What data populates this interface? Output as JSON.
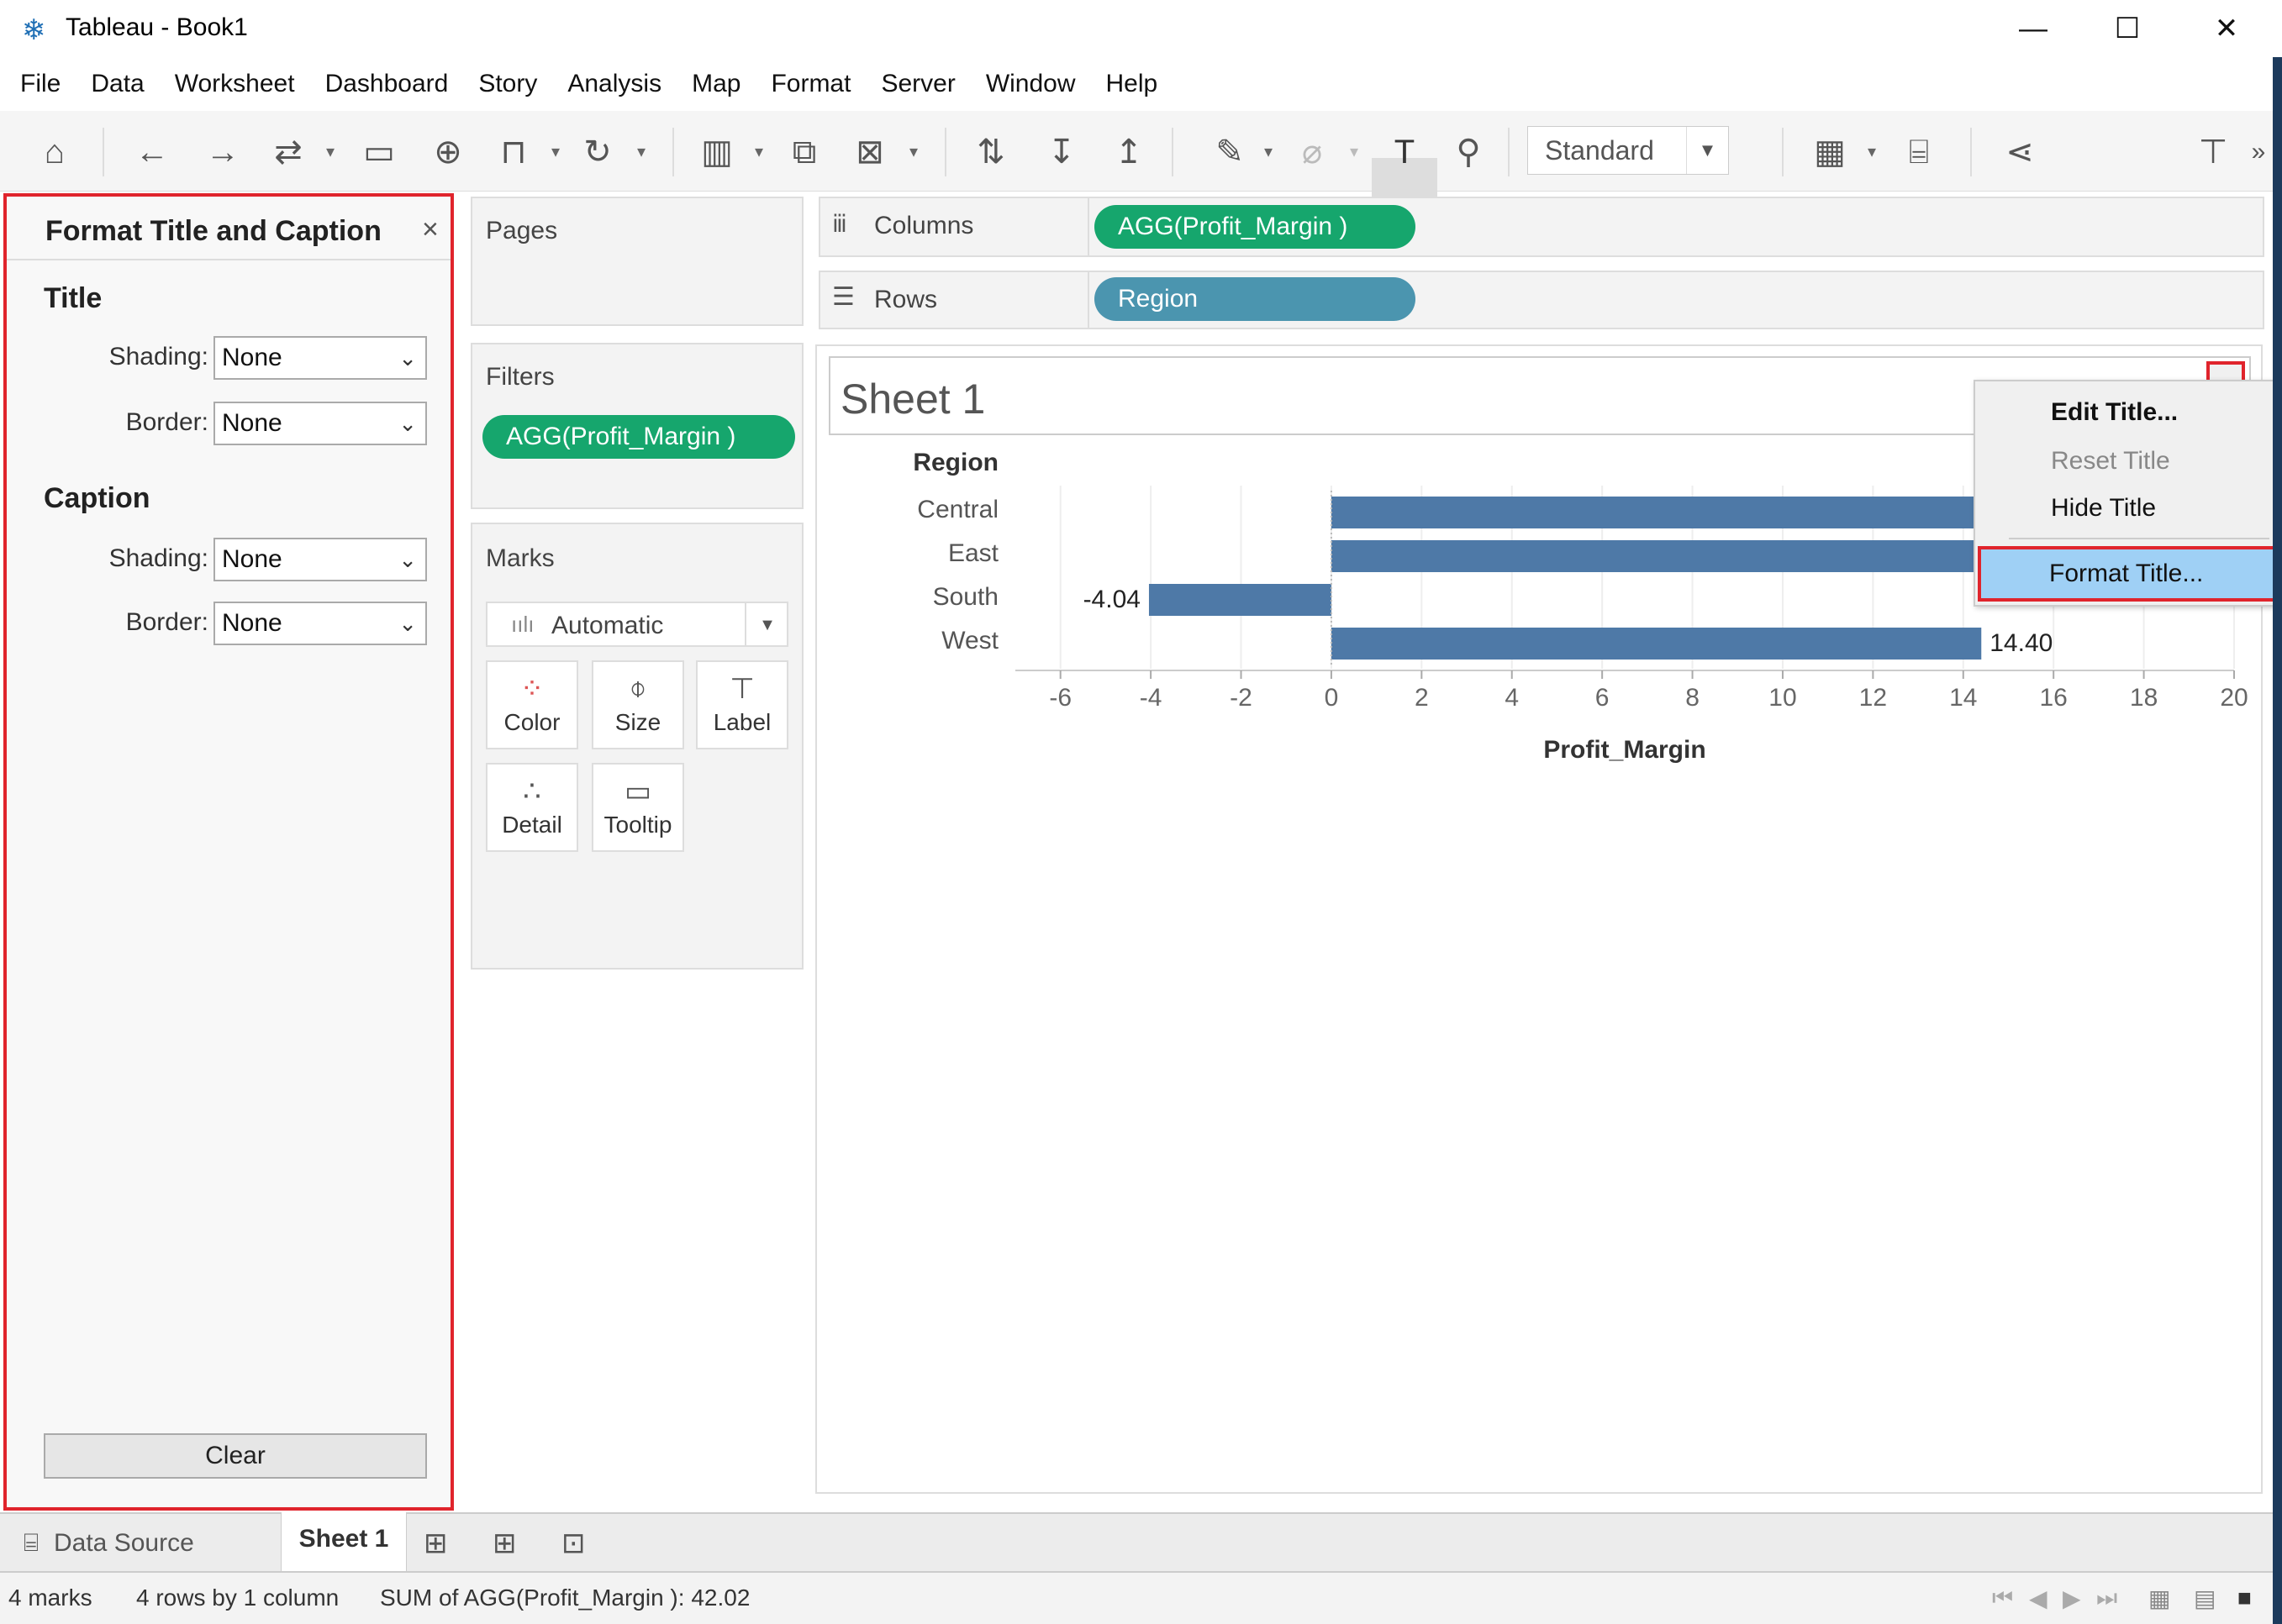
{
  "window": {
    "title": "Tableau - Book1",
    "minimize": "—",
    "maximize": "☐",
    "close": "✕"
  },
  "menu": [
    "File",
    "Data",
    "Worksheet",
    "Dashboard",
    "Story",
    "Analysis",
    "Map",
    "Format",
    "Server",
    "Window",
    "Help"
  ],
  "toolbar": {
    "fit_value": "Standard"
  },
  "format_panel": {
    "header": "Format Title and Caption",
    "close": "×",
    "title_section": "Title",
    "caption_section": "Caption",
    "shading_label": "Shading:",
    "border_label": "Border:",
    "title_shading": "None",
    "title_border": "None",
    "caption_shading": "None",
    "caption_border": "None",
    "clear_label": "Clear"
  },
  "cards": {
    "pages": "Pages",
    "filters": "Filters",
    "filter_pill": "AGG(Profit_Margin )",
    "marks": "Marks",
    "mark_type": "Automatic",
    "mark_buttons": [
      "Color",
      "Size",
      "Label",
      "Detail",
      "Tooltip"
    ]
  },
  "shelves": {
    "columns_label": "Columns",
    "rows_label": "Rows",
    "columns_pill": "AGG(Profit_Margin )",
    "rows_pill": "Region"
  },
  "sheet": {
    "title": "Sheet 1"
  },
  "context_menu": {
    "edit": "Edit Title...",
    "reset": "Reset Title",
    "hide": "Hide Title",
    "format": "Format Title..."
  },
  "chart_data": {
    "type": "bar",
    "orientation": "horizontal",
    "row_header": "Region",
    "categories": [
      "Central",
      "East",
      "South",
      "West"
    ],
    "values": [
      14.5,
      14.5,
      -4.04,
      14.4
    ],
    "data_labels": [
      "",
      "",
      "-4.04",
      "14.40"
    ],
    "xlabel": "Profit_Margin",
    "xlim": [
      -7,
      20
    ],
    "xticks": [
      -6,
      -4,
      -2,
      0,
      2,
      4,
      6,
      8,
      10,
      12,
      14,
      16,
      18,
      20
    ],
    "bar_color": "#4e79a7",
    "grid": true
  },
  "tabs": {
    "data_source": "Data Source",
    "sheet": "Sheet 1"
  },
  "status": {
    "marks": "4 marks",
    "dims": "4 rows by 1 column",
    "sum": "SUM of AGG(Profit_Margin ): 42.02"
  },
  "colors": {
    "accent_red": "#e0242c",
    "pill_green": "#16a66d",
    "pill_blue": "#4b95af",
    "menu_highlight": "#9fd0f5"
  }
}
